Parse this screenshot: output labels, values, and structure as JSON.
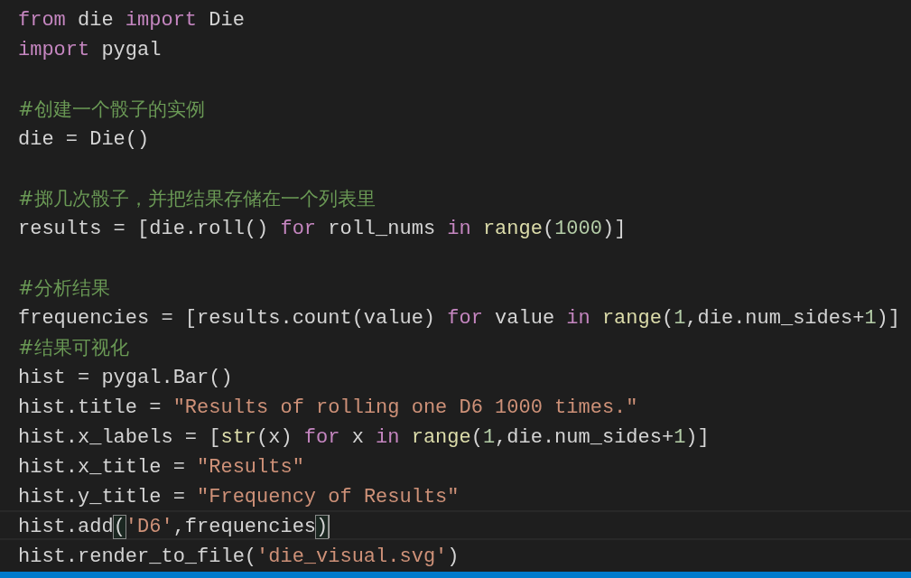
{
  "editor": {
    "lines": [
      {
        "current": false,
        "tokens": [
          {
            "kind": "keyword",
            "text": "from"
          },
          {
            "kind": "plain",
            "text": " die "
          },
          {
            "kind": "keyword",
            "text": "import"
          },
          {
            "kind": "plain",
            "text": " Die"
          }
        ]
      },
      {
        "current": false,
        "tokens": [
          {
            "kind": "keyword",
            "text": "import"
          },
          {
            "kind": "plain",
            "text": " pygal"
          }
        ]
      },
      {
        "current": false
      },
      {
        "current": false,
        "tokens": [
          {
            "kind": "comment",
            "text": "#创建一个骰子的实例"
          }
        ]
      },
      {
        "current": false,
        "tokens": [
          {
            "kind": "plain",
            "text": "die = Die()"
          }
        ]
      },
      {
        "current": false
      },
      {
        "current": false,
        "tokens": [
          {
            "kind": "comment",
            "text": "#掷几次骰子，并把结果存储在一个列表里"
          }
        ]
      },
      {
        "current": false,
        "tokens": [
          {
            "kind": "plain",
            "text": "results = [die.roll() "
          },
          {
            "kind": "keyword",
            "text": "for"
          },
          {
            "kind": "plain",
            "text": " roll_nums "
          },
          {
            "kind": "keyword",
            "text": "in "
          },
          {
            "kind": "builtin",
            "text": "range"
          },
          {
            "kind": "plain",
            "text": "("
          },
          {
            "kind": "number",
            "text": "1000"
          },
          {
            "kind": "plain",
            "text": ")]"
          }
        ]
      },
      {
        "current": false
      },
      {
        "current": false,
        "tokens": [
          {
            "kind": "comment",
            "text": "#分析结果"
          }
        ]
      },
      {
        "current": false,
        "tokens": [
          {
            "kind": "plain",
            "text": "frequencies = [results.count(value) "
          },
          {
            "kind": "keyword",
            "text": "for"
          },
          {
            "kind": "plain",
            "text": " value "
          },
          {
            "kind": "keyword",
            "text": "in "
          },
          {
            "kind": "builtin",
            "text": "range"
          },
          {
            "kind": "plain",
            "text": "("
          },
          {
            "kind": "number",
            "text": "1"
          },
          {
            "kind": "plain",
            "text": ",die.num_sides+"
          },
          {
            "kind": "number",
            "text": "1"
          },
          {
            "kind": "plain",
            "text": ")]"
          }
        ]
      },
      {
        "current": false,
        "tokens": [
          {
            "kind": "comment",
            "text": "#结果可视化"
          }
        ]
      },
      {
        "current": false,
        "tokens": [
          {
            "kind": "plain",
            "text": "hist = pygal.Bar()"
          }
        ]
      },
      {
        "current": false,
        "tokens": [
          {
            "kind": "plain",
            "text": "hist.title = "
          },
          {
            "kind": "string",
            "text": "\"Results of rolling one D6 1000 times.\""
          }
        ]
      },
      {
        "current": false,
        "tokens": [
          {
            "kind": "plain",
            "text": "hist.x_labels = ["
          },
          {
            "kind": "builtin",
            "text": "str"
          },
          {
            "kind": "plain",
            "text": "(x) "
          },
          {
            "kind": "keyword",
            "text": "for"
          },
          {
            "kind": "plain",
            "text": " x "
          },
          {
            "kind": "keyword",
            "text": "in "
          },
          {
            "kind": "builtin",
            "text": "range"
          },
          {
            "kind": "plain",
            "text": "("
          },
          {
            "kind": "number",
            "text": "1"
          },
          {
            "kind": "plain",
            "text": ",die.num_sides+"
          },
          {
            "kind": "number",
            "text": "1"
          },
          {
            "kind": "plain",
            "text": ")]"
          }
        ]
      },
      {
        "current": false,
        "tokens": [
          {
            "kind": "plain",
            "text": "hist.x_title = "
          },
          {
            "kind": "string",
            "text": "\"Results\""
          }
        ]
      },
      {
        "current": false,
        "tokens": [
          {
            "kind": "plain",
            "text": "hist.y_title = "
          },
          {
            "kind": "string",
            "text": "\"Frequency of Results\""
          }
        ]
      },
      {
        "current": true,
        "tokens": [
          {
            "kind": "plain",
            "text": "hist.add"
          },
          {
            "kind": "bracket_match",
            "text": "("
          },
          {
            "kind": "string",
            "text": "'D6'"
          },
          {
            "kind": "plain",
            "text": ",frequencies"
          },
          {
            "kind": "bracket_match",
            "text": ")"
          }
        ]
      },
      {
        "current": false,
        "tokens": [
          {
            "kind": "plain",
            "text": "hist.render_to_file("
          },
          {
            "kind": "string",
            "text": "'die_visual.svg'"
          },
          {
            "kind": "plain",
            "text": ")"
          }
        ]
      }
    ]
  }
}
